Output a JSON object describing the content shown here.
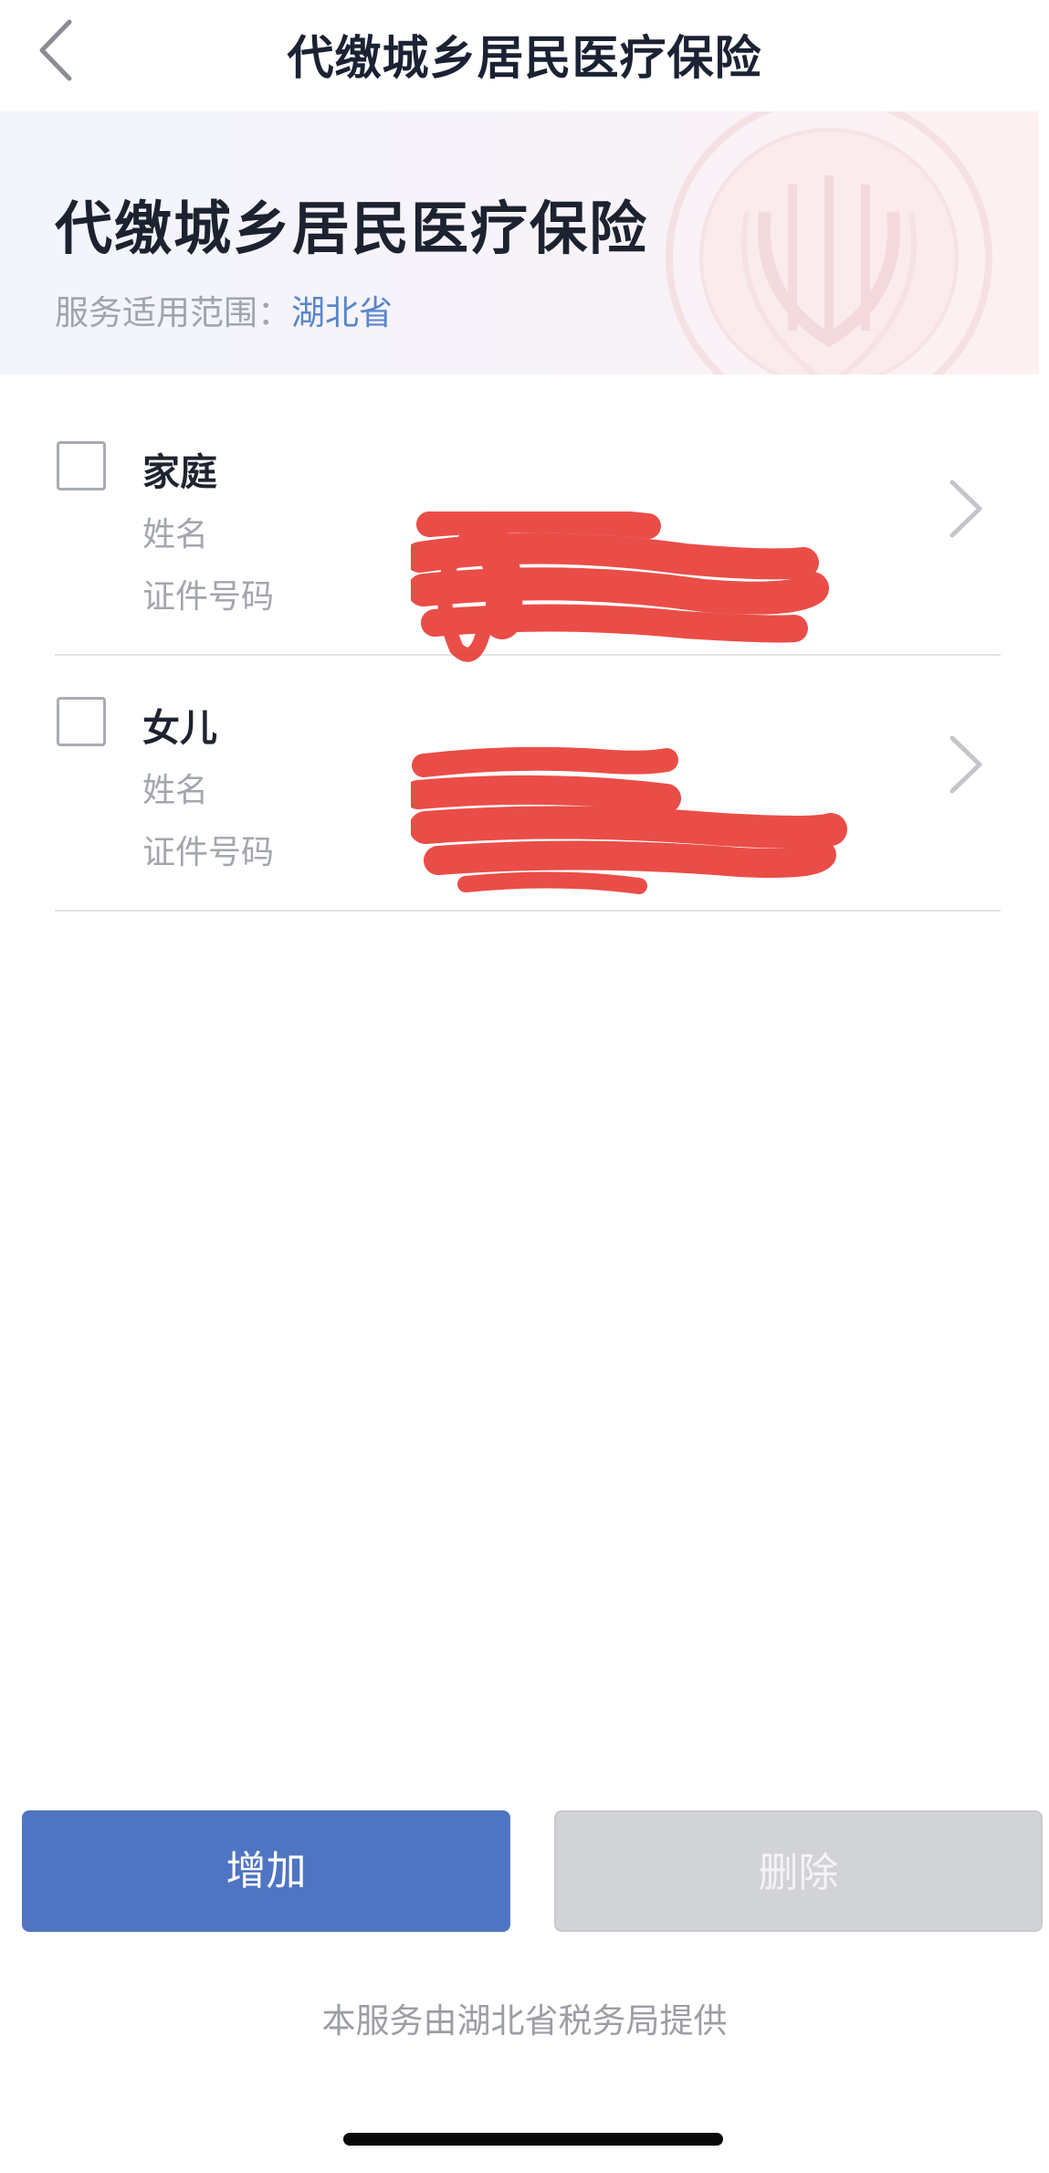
{
  "navbar": {
    "title": "代缴城乡居民医疗保险"
  },
  "banner": {
    "title": "代缴城乡居民医疗保险",
    "scope_label": "服务适用范围：",
    "scope_value": "湖北省"
  },
  "list": {
    "items": [
      {
        "name": "家庭",
        "name_label": "姓名",
        "id_label": "证件号码",
        "checked": false
      },
      {
        "name": "女儿",
        "name_label": "姓名",
        "id_label": "证件号码",
        "checked": false
      }
    ]
  },
  "actions": {
    "add_label": "增加",
    "delete_label": "删除"
  },
  "footer": {
    "note": "本服务由湖北省税务局提供"
  },
  "colors": {
    "primary_button": "#4f75c2",
    "disabled_button": "#d2d3d6",
    "scope_link": "#5b86c8",
    "redaction": "#e8352e"
  }
}
